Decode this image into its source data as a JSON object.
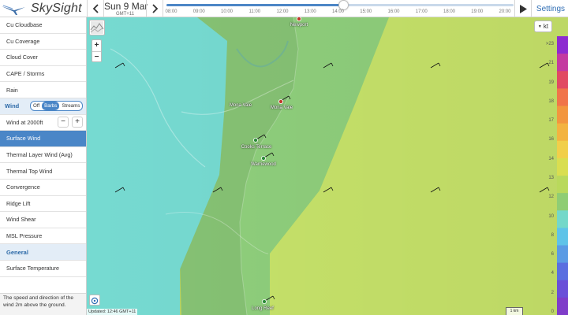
{
  "app": {
    "name": "SkySight"
  },
  "header": {
    "date": "Sun 9 Mar",
    "timezone": "GMT+11",
    "time_ticks": [
      "08:00",
      "09:00",
      "10:00",
      "11:00",
      "12:00",
      "13:00",
      "14:00",
      "15:00",
      "16:00",
      "17:00",
      "18:00",
      "19:00",
      "20:00"
    ],
    "timeline_position": 0.51,
    "settings_label": "Settings"
  },
  "sidebar": {
    "items_top": [
      {
        "label": "Cu Cloudbase"
      },
      {
        "label": "Cu Coverage"
      },
      {
        "label": "Cloud Cover"
      },
      {
        "label": "CAPE / Storms"
      },
      {
        "label": "Rain"
      }
    ],
    "wind_section": {
      "label": "Wind",
      "options": [
        "Off",
        "Barbs",
        "Streams"
      ],
      "selected": "Barbs",
      "altitude_label": "Wind at 2000ft",
      "minus_label": "−",
      "plus_label": "+"
    },
    "items_wind": [
      {
        "label": "Surface Wind",
        "active": true
      },
      {
        "label": "Thermal Layer Wind (Avg)"
      },
      {
        "label": "Thermal Top Wind"
      },
      {
        "label": "Convergence"
      },
      {
        "label": "Ridge Lift"
      },
      {
        "label": "Wind Shear"
      },
      {
        "label": "MSL Pressure"
      }
    ],
    "general_section": {
      "label": "General"
    },
    "items_general": [
      {
        "label": "Surface Temperature"
      }
    ],
    "description": "The speed and direction of the wind 2m above the ground."
  },
  "map": {
    "units": "kt",
    "places": [
      {
        "name": "Newport"
      },
      {
        "name": "Mona Vale"
      },
      {
        "name": "Mona Vale"
      },
      {
        "name": "Cooks Terrace"
      },
      {
        "name": "Warriewood"
      },
      {
        "name": "Long Reef"
      }
    ],
    "legend": {
      "labels": [
        ">23",
        "21",
        "19",
        "18",
        "17",
        "16",
        "14",
        "13",
        "12",
        "10",
        "8",
        "6",
        "4",
        "2",
        "0"
      ],
      "colors": [
        "#8d2bd0",
        "#c43aa0",
        "#e14a63",
        "#f0744a",
        "#f2963f",
        "#f3b340",
        "#f1cf4a",
        "#d9de50",
        "#b9d95c",
        "#8fcd74",
        "#74d8c9",
        "#5fc3e8",
        "#5b9be4",
        "#5a6fe0",
        "#6a4fd8",
        "#7f3dc9"
      ]
    },
    "updated": "Updated: 12:46 GMT+11",
    "scale": "1 km",
    "colors": {
      "calm": "#7ee8df",
      "light": "#8fcf7c",
      "moderate": "#c7e36a"
    }
  }
}
